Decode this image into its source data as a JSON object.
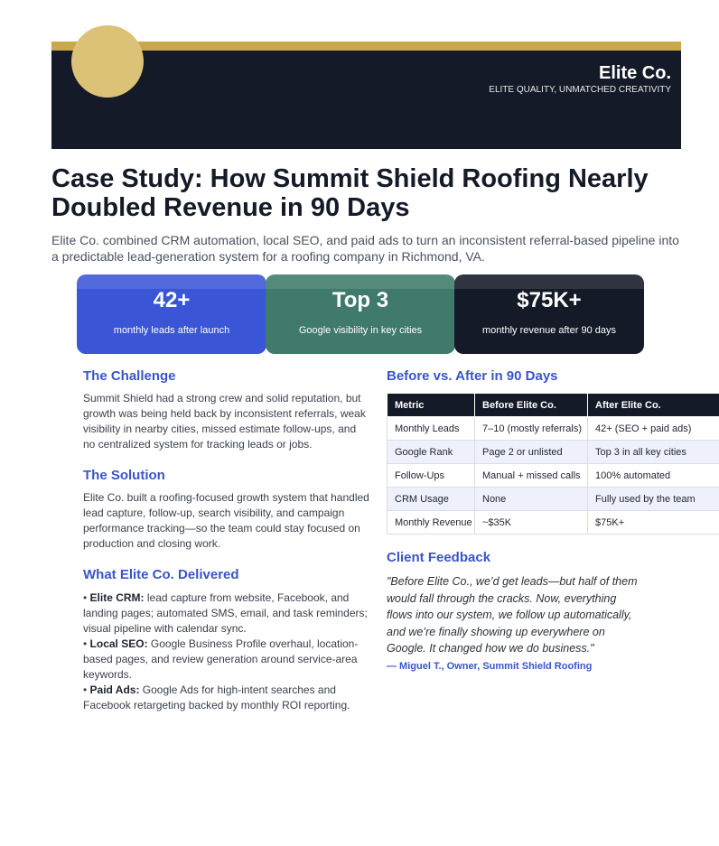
{
  "header": {
    "brand": "Elite Co.",
    "tagline": "ELITE QUALITY, UNMATCHED CREATIVITY"
  },
  "title": "Case Study: How Summit Shield Roofing Nearly Doubled Revenue in 90 Days",
  "subtitle": "Elite Co. combined CRM automation, local SEO, and paid ads to turn an inconsistent referral-based pipeline into a predictable lead-generation system for a roofing company in Richmond, VA.",
  "stats": [
    {
      "value": "42+",
      "label": "monthly leads after launch"
    },
    {
      "value": "Top 3",
      "label": "Google visibility in key cities"
    },
    {
      "value": "$75K+",
      "label": "monthly revenue after 90 days"
    }
  ],
  "challenge": {
    "heading": "The Challenge",
    "text": "Summit Shield had a strong crew and solid reputation, but growth was being held back by inconsistent referrals, weak visibility in nearby cities, missed estimate follow-ups, and no centralized system for tracking leads or jobs."
  },
  "solution": {
    "heading": "The Solution",
    "text": "Elite Co. built a roofing-focused growth system that handled lead capture, follow-up, search visibility, and campaign performance tracking—so the team could stay focused on production and closing work."
  },
  "delivered": {
    "heading": "What Elite Co. Delivered",
    "items": [
      {
        "bullet": "• ",
        "label": "Elite CRM:",
        "text": " lead capture from website, Facebook, and landing pages; automated SMS, email, and task reminders; visual pipeline with calendar sync."
      },
      {
        "bullet": "• ",
        "label": "Local SEO:",
        "text": " Google Business Profile overhaul, location-based pages, and review generation around service-area keywords."
      },
      {
        "bullet": "• ",
        "label": "Paid Ads:",
        "text": " Google Ads for high-intent searches and Facebook retargeting backed by monthly ROI reporting."
      }
    ]
  },
  "comparison": {
    "heading": "Before vs. After in 90 Days",
    "headers": [
      "Metric",
      "Before Elite Co.",
      "After Elite Co."
    ],
    "rows": [
      [
        "Monthly Leads",
        "7–10 (mostly referrals)",
        "42+ (SEO + paid ads)"
      ],
      [
        "Google Rank",
        "Page 2 or unlisted",
        "Top 3 in all key cities"
      ],
      [
        "Follow-Ups",
        "Manual + missed calls",
        "100% automated"
      ],
      [
        "CRM Usage",
        "None",
        "Fully used by the team"
      ],
      [
        "Monthly Revenue",
        "~$35K",
        "$75K+"
      ]
    ]
  },
  "feedback": {
    "heading": "Client Feedback",
    "quote": "\"Before Elite Co., we’d get leads—but half of them would fall through the cracks. Now, everything flows into our system, we follow up automatically, and we’re finally showing up everywhere on Google. It changed how we do business.\"",
    "author": "— Miguel T., Owner, Summit Shield Roofing"
  },
  "colors": {
    "accent_gold": "#c9a84c",
    "navy": "#141a27",
    "blue": "#3a55d6",
    "teal": "#3f7a6c",
    "heading_blue": "#3a55c8"
  }
}
